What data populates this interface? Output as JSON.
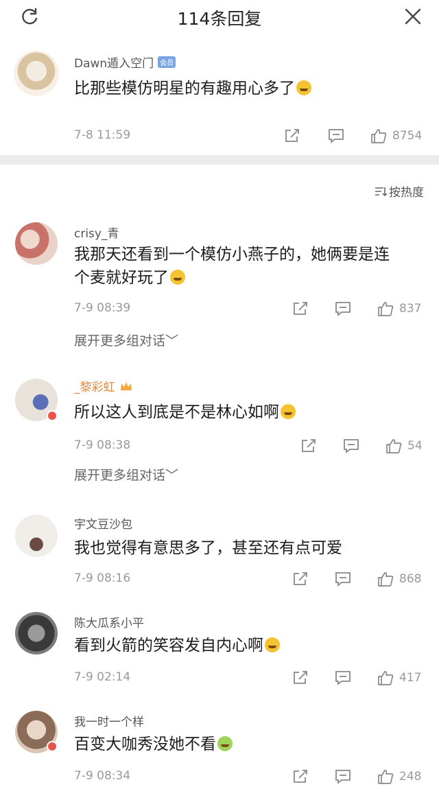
{
  "header": {
    "title": "114条回复"
  },
  "root_comment": {
    "username": "Dawn遁入空门",
    "badge": "会员",
    "text": "比那些模仿明星的有趣用心多了",
    "time": "7-8 11:59",
    "likes": "8754"
  },
  "sort_label": "按热度",
  "replies": [
    {
      "username": "crisy_青",
      "text_line1": "我那天还看到一个模仿小燕子的，她俩要是连",
      "text_line2": "个麦就好玩了",
      "time": "7-9 08:39",
      "likes": "837",
      "expand": "展开更多组对话﹀"
    },
    {
      "username": "_黎彩虹",
      "text": "所以这人到底是不是林心如啊",
      "time": "7-9 08:38",
      "likes": "54",
      "expand": "展开更多组对话﹀"
    },
    {
      "username": "宇文豆沙包",
      "text": "我也觉得有意思多了，甚至还有点可爱",
      "time": "7-9 08:16",
      "likes": "868"
    },
    {
      "username": "陈大瓜系小平",
      "text": "看到火箭的笑容发自内心啊",
      "time": "7-9 02:14",
      "likes": "417"
    },
    {
      "username": "我一时一个样",
      "text": "百变大咖秀没她不看",
      "time": "7-9 08:34",
      "likes": "248"
    }
  ]
}
